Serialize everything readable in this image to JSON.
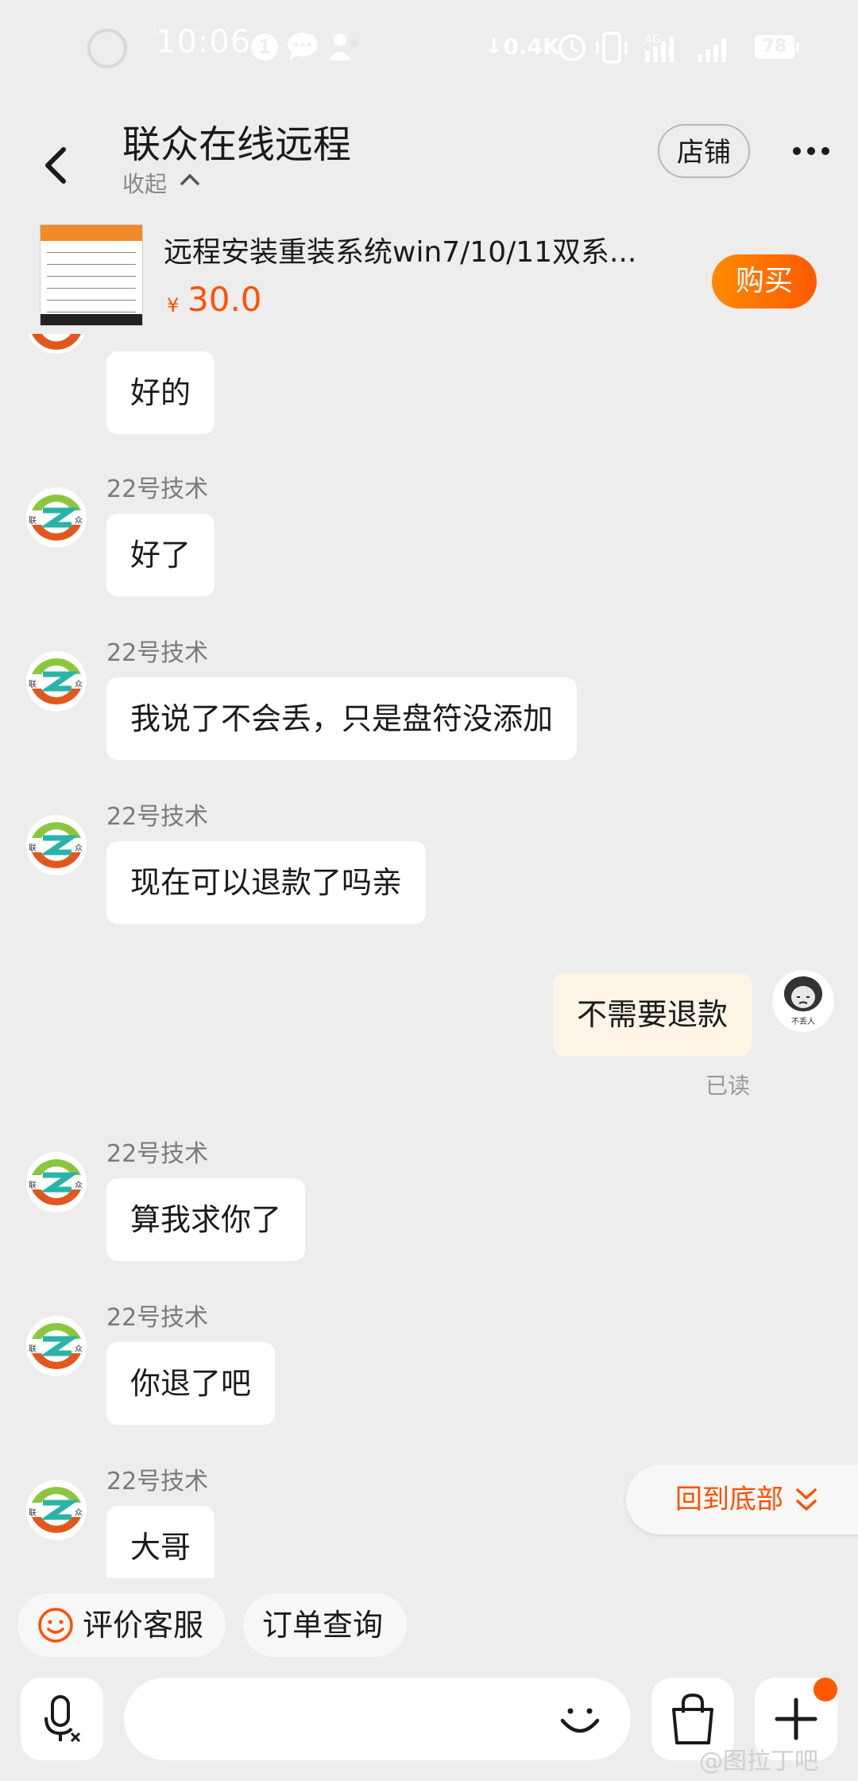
{
  "status_bar": {
    "time": "10:06",
    "notification_count": "1",
    "net_speed": "↓0.4K",
    "battery": "78"
  },
  "header": {
    "title": "联众在线远程",
    "collapse_label": "收起",
    "store_button": "店铺"
  },
  "product": {
    "title": "远程安装重装系统win7/10/11双系...",
    "currency": "¥",
    "price": "30.0",
    "buy_button": "购买"
  },
  "messages": [
    {
      "from": "shop",
      "sender": "",
      "text": "好的"
    },
    {
      "from": "shop",
      "sender": "22号技术",
      "text": "好了"
    },
    {
      "from": "shop",
      "sender": "22号技术",
      "text": "我说了不会丢，只是盘符没添加"
    },
    {
      "from": "shop",
      "sender": "22号技术",
      "text": "现在可以退款了吗亲"
    },
    {
      "from": "me",
      "text": "不需要退款",
      "status": "已读"
    },
    {
      "from": "shop",
      "sender": "22号技术",
      "text": "算我求你了"
    },
    {
      "from": "shop",
      "sender": "22号技术",
      "text": "你退了吧"
    },
    {
      "from": "shop",
      "sender": "22号技术",
      "text": "大哥"
    }
  ],
  "shop_avatar_text": [
    "联",
    "众"
  ],
  "me_avatar_caption": "不丢人",
  "scroll_to_bottom": "回到底部",
  "quick_actions": {
    "rate_service": "评价客服",
    "order_query": "订单查询"
  },
  "input": {
    "placeholder": ""
  },
  "watermark": "@图拉丁吧",
  "colors": {
    "accent": "#ff5000",
    "background": "#ededed",
    "my_bubble": "#fff4e6"
  }
}
